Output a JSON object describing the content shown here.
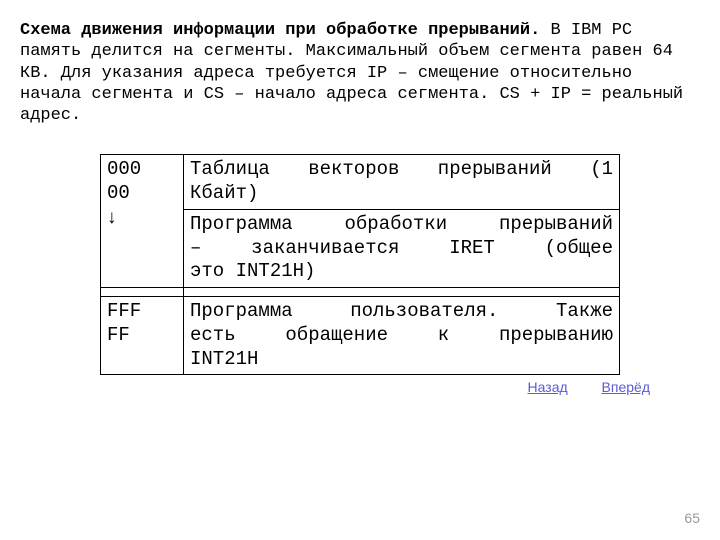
{
  "heading": "Схема движения информации при обработке прерываний.",
  "body": "В IBM PC память делится на сегменты. Максимальный объем сегмента равен 64 КВ. Для указания адреса требуется IP – смещение относительно начала сегмента и CS – начало адреса сегмента. CS + IP = реальный адрес.",
  "table": {
    "row1": {
      "addr": "000\n00\n↓",
      "desc_l1": "Таблица векторов прерываний (1",
      "desc_l2": "Кбайт)"
    },
    "row2": {
      "addr": "",
      "desc_l1": "Программа обработки прерываний",
      "desc_l2": "– заканчивается IRET (общее",
      "desc_l3": "это INT21H)"
    },
    "row4": {
      "addr": "FFF\nFF",
      "desc_l1": "Программа пользователя. Также",
      "desc_l2": "есть обращение к прерыванию",
      "desc_l3": "INT21H"
    }
  },
  "links": {
    "back": "Назад",
    "forward": "Вперёд"
  },
  "page_number": "65"
}
